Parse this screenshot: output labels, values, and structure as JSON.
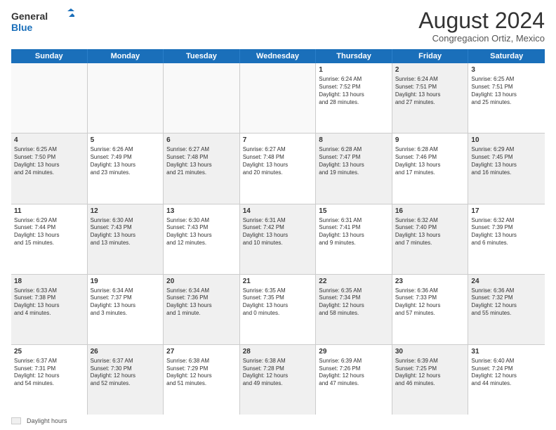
{
  "logo": {
    "general": "General",
    "blue": "Blue"
  },
  "title": {
    "month_year": "August 2024",
    "location": "Congregacion Ortiz, Mexico"
  },
  "header_days": [
    "Sunday",
    "Monday",
    "Tuesday",
    "Wednesday",
    "Thursday",
    "Friday",
    "Saturday"
  ],
  "weeks": [
    {
      "cells": [
        {
          "day": "",
          "info": "",
          "shaded": false,
          "empty": true
        },
        {
          "day": "",
          "info": "",
          "shaded": false,
          "empty": true
        },
        {
          "day": "",
          "info": "",
          "shaded": false,
          "empty": true
        },
        {
          "day": "",
          "info": "",
          "shaded": false,
          "empty": true
        },
        {
          "day": "1",
          "info": "Sunrise: 6:24 AM\nSunset: 7:52 PM\nDaylight: 13 hours\nand 28 minutes.",
          "shaded": false,
          "empty": false
        },
        {
          "day": "2",
          "info": "Sunrise: 6:24 AM\nSunset: 7:51 PM\nDaylight: 13 hours\nand 27 minutes.",
          "shaded": true,
          "empty": false
        },
        {
          "day": "3",
          "info": "Sunrise: 6:25 AM\nSunset: 7:51 PM\nDaylight: 13 hours\nand 25 minutes.",
          "shaded": false,
          "empty": false
        }
      ]
    },
    {
      "cells": [
        {
          "day": "4",
          "info": "Sunrise: 6:25 AM\nSunset: 7:50 PM\nDaylight: 13 hours\nand 24 minutes.",
          "shaded": true,
          "empty": false
        },
        {
          "day": "5",
          "info": "Sunrise: 6:26 AM\nSunset: 7:49 PM\nDaylight: 13 hours\nand 23 minutes.",
          "shaded": false,
          "empty": false
        },
        {
          "day": "6",
          "info": "Sunrise: 6:27 AM\nSunset: 7:48 PM\nDaylight: 13 hours\nand 21 minutes.",
          "shaded": true,
          "empty": false
        },
        {
          "day": "7",
          "info": "Sunrise: 6:27 AM\nSunset: 7:48 PM\nDaylight: 13 hours\nand 20 minutes.",
          "shaded": false,
          "empty": false
        },
        {
          "day": "8",
          "info": "Sunrise: 6:28 AM\nSunset: 7:47 PM\nDaylight: 13 hours\nand 19 minutes.",
          "shaded": true,
          "empty": false
        },
        {
          "day": "9",
          "info": "Sunrise: 6:28 AM\nSunset: 7:46 PM\nDaylight: 13 hours\nand 17 minutes.",
          "shaded": false,
          "empty": false
        },
        {
          "day": "10",
          "info": "Sunrise: 6:29 AM\nSunset: 7:45 PM\nDaylight: 13 hours\nand 16 minutes.",
          "shaded": true,
          "empty": false
        }
      ]
    },
    {
      "cells": [
        {
          "day": "11",
          "info": "Sunrise: 6:29 AM\nSunset: 7:44 PM\nDaylight: 13 hours\nand 15 minutes.",
          "shaded": false,
          "empty": false
        },
        {
          "day": "12",
          "info": "Sunrise: 6:30 AM\nSunset: 7:43 PM\nDaylight: 13 hours\nand 13 minutes.",
          "shaded": true,
          "empty": false
        },
        {
          "day": "13",
          "info": "Sunrise: 6:30 AM\nSunset: 7:43 PM\nDaylight: 13 hours\nand 12 minutes.",
          "shaded": false,
          "empty": false
        },
        {
          "day": "14",
          "info": "Sunrise: 6:31 AM\nSunset: 7:42 PM\nDaylight: 13 hours\nand 10 minutes.",
          "shaded": true,
          "empty": false
        },
        {
          "day": "15",
          "info": "Sunrise: 6:31 AM\nSunset: 7:41 PM\nDaylight: 13 hours\nand 9 minutes.",
          "shaded": false,
          "empty": false
        },
        {
          "day": "16",
          "info": "Sunrise: 6:32 AM\nSunset: 7:40 PM\nDaylight: 13 hours\nand 7 minutes.",
          "shaded": true,
          "empty": false
        },
        {
          "day": "17",
          "info": "Sunrise: 6:32 AM\nSunset: 7:39 PM\nDaylight: 13 hours\nand 6 minutes.",
          "shaded": false,
          "empty": false
        }
      ]
    },
    {
      "cells": [
        {
          "day": "18",
          "info": "Sunrise: 6:33 AM\nSunset: 7:38 PM\nDaylight: 13 hours\nand 4 minutes.",
          "shaded": true,
          "empty": false
        },
        {
          "day": "19",
          "info": "Sunrise: 6:34 AM\nSunset: 7:37 PM\nDaylight: 13 hours\nand 3 minutes.",
          "shaded": false,
          "empty": false
        },
        {
          "day": "20",
          "info": "Sunrise: 6:34 AM\nSunset: 7:36 PM\nDaylight: 13 hours\nand 1 minute.",
          "shaded": true,
          "empty": false
        },
        {
          "day": "21",
          "info": "Sunrise: 6:35 AM\nSunset: 7:35 PM\nDaylight: 13 hours\nand 0 minutes.",
          "shaded": false,
          "empty": false
        },
        {
          "day": "22",
          "info": "Sunrise: 6:35 AM\nSunset: 7:34 PM\nDaylight: 12 hours\nand 58 minutes.",
          "shaded": true,
          "empty": false
        },
        {
          "day": "23",
          "info": "Sunrise: 6:36 AM\nSunset: 7:33 PM\nDaylight: 12 hours\nand 57 minutes.",
          "shaded": false,
          "empty": false
        },
        {
          "day": "24",
          "info": "Sunrise: 6:36 AM\nSunset: 7:32 PM\nDaylight: 12 hours\nand 55 minutes.",
          "shaded": true,
          "empty": false
        }
      ]
    },
    {
      "cells": [
        {
          "day": "25",
          "info": "Sunrise: 6:37 AM\nSunset: 7:31 PM\nDaylight: 12 hours\nand 54 minutes.",
          "shaded": false,
          "empty": false
        },
        {
          "day": "26",
          "info": "Sunrise: 6:37 AM\nSunset: 7:30 PM\nDaylight: 12 hours\nand 52 minutes.",
          "shaded": true,
          "empty": false
        },
        {
          "day": "27",
          "info": "Sunrise: 6:38 AM\nSunset: 7:29 PM\nDaylight: 12 hours\nand 51 minutes.",
          "shaded": false,
          "empty": false
        },
        {
          "day": "28",
          "info": "Sunrise: 6:38 AM\nSunset: 7:28 PM\nDaylight: 12 hours\nand 49 minutes.",
          "shaded": true,
          "empty": false
        },
        {
          "day": "29",
          "info": "Sunrise: 6:39 AM\nSunset: 7:26 PM\nDaylight: 12 hours\nand 47 minutes.",
          "shaded": false,
          "empty": false
        },
        {
          "day": "30",
          "info": "Sunrise: 6:39 AM\nSunset: 7:25 PM\nDaylight: 12 hours\nand 46 minutes.",
          "shaded": true,
          "empty": false
        },
        {
          "day": "31",
          "info": "Sunrise: 6:40 AM\nSunset: 7:24 PM\nDaylight: 12 hours\nand 44 minutes.",
          "shaded": false,
          "empty": false
        }
      ]
    }
  ],
  "legend": {
    "box_label": "Daylight hours"
  }
}
